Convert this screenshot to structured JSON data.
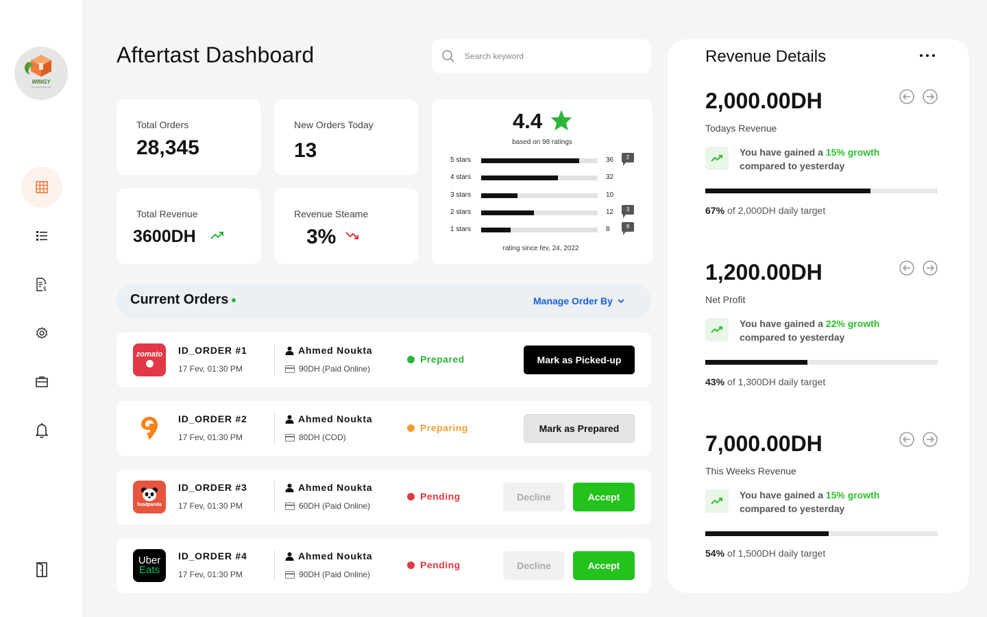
{
  "app": {
    "title": "Aftertast Dashboard",
    "logo_text": "WINGY",
    "logo_subtext": "fly to your dream way"
  },
  "sidebar": {
    "items": [
      {
        "name": "dashboard",
        "icon": "grid-icon",
        "active": true
      },
      {
        "name": "orders-list",
        "icon": "list-icon",
        "active": false
      },
      {
        "name": "invoices",
        "icon": "invoice-icon",
        "active": false
      },
      {
        "name": "settings",
        "icon": "gear-icon",
        "active": false
      },
      {
        "name": "inventory",
        "icon": "briefcase-icon",
        "active": false
      },
      {
        "name": "notifications",
        "icon": "bell-icon",
        "active": false
      }
    ],
    "logout_icon": "door-icon"
  },
  "search": {
    "placeholder": "Search keyword",
    "value": ""
  },
  "stats": {
    "total_orders": {
      "label": "Total Orders",
      "value": "28,345"
    },
    "new_orders": {
      "label": "New Orders Today",
      "value": "13"
    },
    "total_revenue": {
      "label": "Total Revenue",
      "value": "3600DH",
      "trend": "up"
    },
    "revenue_stream": {
      "label": "Revenue Steame",
      "value": "3%",
      "trend": "down"
    }
  },
  "ratings": {
    "average": "4.4",
    "based_on": "based on 98 ratings",
    "since": "rating since fev, 24, 2022",
    "rows": [
      {
        "label": "5 stars",
        "count": "36",
        "fill": 0.84,
        "comments": "2"
      },
      {
        "label": "4 stars",
        "count": "32",
        "fill": 0.66,
        "comments": ""
      },
      {
        "label": "3 stars",
        "count": "10",
        "fill": 0.31,
        "comments": ""
      },
      {
        "label": "2 stars",
        "count": "12",
        "fill": 0.45,
        "comments": "3"
      },
      {
        "label": "1 stars",
        "count": "8",
        "fill": 0.25,
        "comments": "8"
      }
    ]
  },
  "current_orders": {
    "title": "Current Orders",
    "manage_label": "Manage Order By",
    "orders": [
      {
        "id": "ID_ORDER #1",
        "time": "17 Fev, 01:30 PM",
        "customer": "Ahmed Noukta",
        "payment": "90DH (Paid Online)",
        "status": "Prepared",
        "status_color": "#2cb53a",
        "brand": "zomato",
        "action": "Mark as Picked-up"
      },
      {
        "id": "ID_ORDER #2",
        "time": "17 Fev, 01:30 PM",
        "customer": "Ahmed Noukta",
        "payment": "80DH (COD)",
        "status": "Preparing",
        "status_color": "#f0a035",
        "brand": "swiggy",
        "action": "Mark as Prepared"
      },
      {
        "id": "ID_ORDER #3",
        "time": "17 Fev, 01:30 PM",
        "customer": "Ahmed Noukta",
        "payment": "60DH (Paid Online)",
        "status": "Pending",
        "status_color": "#e0383e",
        "brand": "foodpanda",
        "decline": "Decline",
        "accept": "Accept"
      },
      {
        "id": "ID_ORDER #4",
        "time": "17 Fev, 01:30 PM",
        "customer": "Ahmed Noukta",
        "payment": "90DH (Paid Online)",
        "status": "Pending",
        "status_color": "#e0383e",
        "brand": "ubereats",
        "decline": "Decline",
        "accept": "Accept"
      }
    ],
    "brand_text": {
      "zomato": "zomato",
      "foodpanda": "foodpanda",
      "uber_line1": "Uber",
      "uber_line2": "Eats"
    }
  },
  "revenue": {
    "title": "Revenue Details",
    "blocks": [
      {
        "amount": "2,000.00DH",
        "name": "Todays Revenue",
        "gain_prefix": "You have gained a ",
        "gain_value": "15% growth",
        "gain_suffix": "compared to yesterday",
        "percent_label": "67%",
        "percent": 0.71,
        "target": "of 2,000DH daily target"
      },
      {
        "amount": "1,200.00DH",
        "name": "Net Profit",
        "gain_prefix": "You have gained a ",
        "gain_value": "22% growth",
        "gain_suffix": "compared to yesterday",
        "percent_label": "43%",
        "percent": 0.44,
        "target": "of 1,300DH daily target"
      },
      {
        "amount": "7,000.00DH",
        "name": "This Weeks Revenue",
        "gain_prefix": "You have gained a ",
        "gain_value": "15% growth",
        "gain_suffix": "compared to yesterday",
        "percent_label": "54%",
        "percent": 0.53,
        "target": "of 1,500DH daily target"
      }
    ]
  },
  "colors": {
    "accent": "#f07a3a",
    "green": "#23c21c",
    "link": "#1a5fd6",
    "red": "#e0383e"
  }
}
